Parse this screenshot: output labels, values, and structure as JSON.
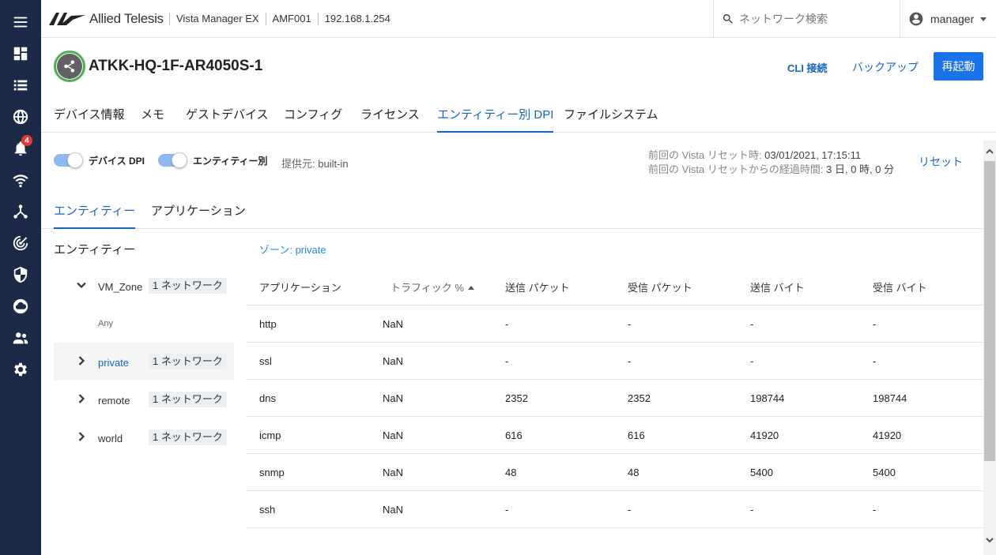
{
  "nav": {
    "items": [
      {
        "icon": "menu-icon"
      },
      {
        "icon": "dashboard-icon"
      },
      {
        "icon": "list-icon"
      },
      {
        "icon": "globe-icon"
      },
      {
        "icon": "bell-icon",
        "badge": "4"
      },
      {
        "icon": "wifi-icon"
      },
      {
        "icon": "topology-icon"
      },
      {
        "icon": "radar-icon"
      },
      {
        "icon": "shield-icon"
      },
      {
        "icon": "cloud-icon"
      },
      {
        "icon": "users-icon"
      },
      {
        "icon": "gear-icon"
      }
    ]
  },
  "topbar": {
    "brand": "Allied Telesis",
    "breadcrumb": [
      "Vista Manager EX",
      "AMF001",
      "192.168.1.254"
    ],
    "search_placeholder": "ネットワーク検索",
    "user": "manager"
  },
  "device": {
    "name": "ATKK-HQ-1F-AR4050S-1",
    "actions": {
      "cli": "CLI 接続",
      "backup": "バックアップ",
      "reboot": "再起動"
    }
  },
  "tabs": [
    "デバイス情報",
    "メモ",
    "ゲストデバイス",
    "コンフィグ",
    "ライセンス",
    "エンティティー別 DPI",
    "ファイルシステム"
  ],
  "active_tab": "エンティティー別 DPI",
  "dpi": {
    "device_dpi_label": "デバイス DPI",
    "device_dpi_on": true,
    "entity_label": "エンティティー別",
    "entity_on": true,
    "provider_label": "提供元:",
    "provider_value": "built-in",
    "last_reset_label": "前回の Vista リセット時:",
    "last_reset_value": "03/01/2021, 17:15:11",
    "elapsed_label": "前回の Vista リセットからの経過時間:",
    "elapsed_value": "3 日, 0 時, 0 分",
    "reset": "リセット"
  },
  "subtabs": [
    "エンティティー",
    "アプリケーション"
  ],
  "tree": {
    "title": "エンティティー",
    "zones": [
      {
        "name": "VM_Zone",
        "badge": "1 ネットワーク",
        "expanded": true,
        "selected": false
      },
      {
        "name": "private",
        "badge": "1 ネットワーク",
        "expanded": false,
        "selected": true
      },
      {
        "name": "remote",
        "badge": "1 ネットワーク",
        "expanded": false,
        "selected": false
      },
      {
        "name": "world",
        "badge": "1 ネットワーク",
        "expanded": false,
        "selected": false
      }
    ],
    "child": "Any"
  },
  "zone_label": "ゾーン: private",
  "table": {
    "columns": [
      "アプリケーション",
      "トラフィック %",
      "送信 パケット",
      "受信 パケット",
      "送信 バイト",
      "受信 バイト"
    ],
    "rows": [
      [
        "http",
        "NaN",
        "-",
        "-",
        "-",
        "-"
      ],
      [
        "ssl",
        "NaN",
        "-",
        "-",
        "-",
        "-"
      ],
      [
        "dns",
        "NaN",
        "2352",
        "2352",
        "198744",
        "198744"
      ],
      [
        "icmp",
        "NaN",
        "616",
        "616",
        "41920",
        "41920"
      ],
      [
        "snmp",
        "NaN",
        "48",
        "48",
        "5400",
        "5400"
      ],
      [
        "ssh",
        "NaN",
        "-",
        "-",
        "-",
        "-"
      ]
    ]
  }
}
